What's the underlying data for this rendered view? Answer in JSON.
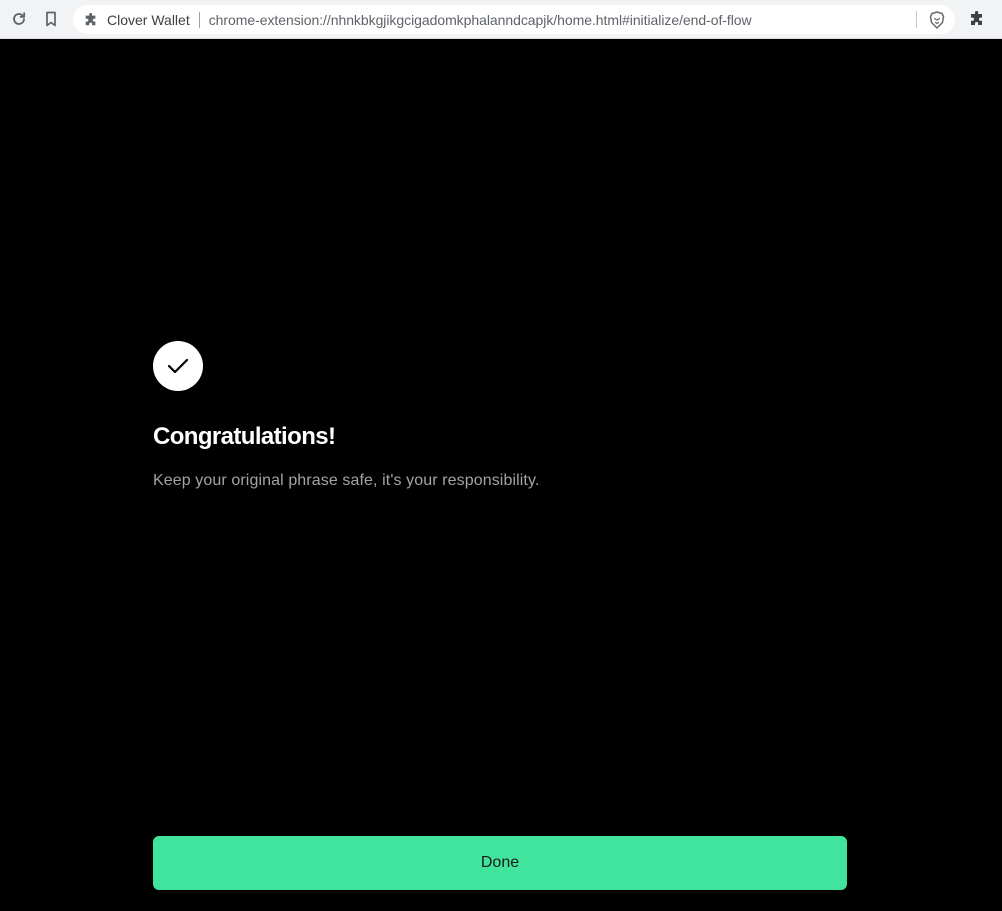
{
  "browser": {
    "extension_name": "Clover Wallet",
    "url": "chrome-extension://nhnkbkgjikgcigadomkphalanndcapjk/home.html#initialize/end-of-flow",
    "icons": {
      "reload": "reload-icon",
      "bookmark": "bookmark-icon",
      "extension_badge": "puzzle-icon",
      "brave": "brave-shield-icon",
      "extensions_menu": "puzzle-icon"
    }
  },
  "page": {
    "icon": "checkmark-icon",
    "title": "Congratulations!",
    "subtitle": "Keep your original phrase safe, it's your responsibility.",
    "done_label": "Done",
    "colors": {
      "background": "#000000",
      "accent": "#40e49d",
      "title": "#ffffff",
      "subtitle": "#a3a3a8"
    }
  }
}
